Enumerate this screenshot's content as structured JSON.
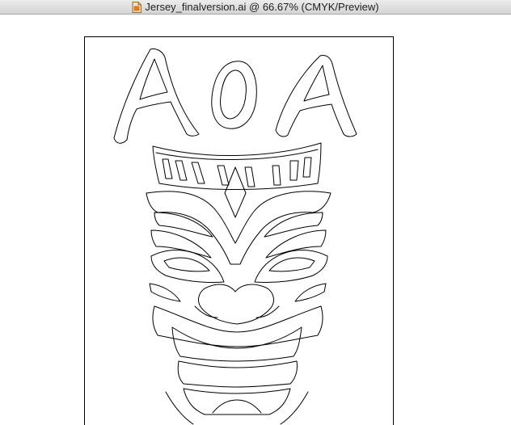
{
  "window": {
    "title": "Jersey_finalversion.ai @ 66.67% (CMYK/Preview)",
    "title_icon": "illustrator-document-icon"
  },
  "artwork": {
    "lettering": "AOA",
    "stroke_color": "#000000",
    "background_color": "#ffffff"
  }
}
